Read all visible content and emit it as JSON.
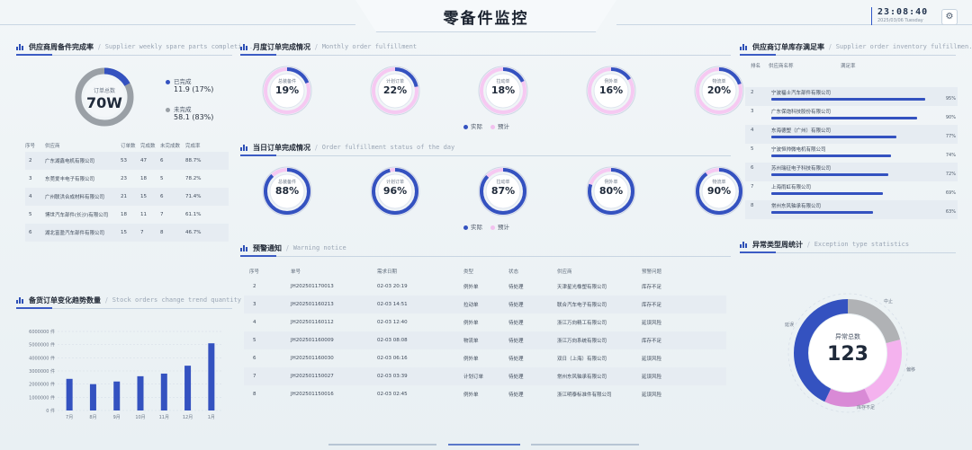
{
  "header": {
    "title": "零备件监控",
    "time": "23:08:40",
    "date": "2025/03/06  Tuesday"
  },
  "supplier_rate": {
    "title": "供应商周备件完成率",
    "subtitle": "Supplier weekly spare parts completi...",
    "center_label": "订单总数",
    "center_value": "70W",
    "completed_label": "已完成",
    "completed_value": "11.9 (17%)",
    "completed_fraction": 0.17,
    "pending_label": "未完成",
    "pending_value": "58.1 (83%)",
    "colors": {
      "completed": "#3452c0",
      "pending": "#9aa0a6"
    },
    "columns": [
      "序号",
      "供应商",
      "订单数",
      "完成数",
      "未完成数",
      "完成率"
    ],
    "rows": [
      [
        "2",
        "广东湖鑫电机有限公司",
        "53",
        "47",
        "6",
        "88.7%"
      ],
      [
        "3",
        "东莞爱丰电子有限公司",
        "23",
        "18",
        "5",
        "78.2%"
      ],
      [
        "4",
        "广州联洪合成材料有限公司",
        "21",
        "15",
        "6",
        "71.4%"
      ],
      [
        "5",
        "博世汽车部件(长沙)有限公司",
        "18",
        "11",
        "7",
        "61.1%"
      ],
      [
        "6",
        "湖北富盈汽车部件有限公司",
        "15",
        "7",
        "8",
        "46.7%"
      ]
    ]
  },
  "monthly": {
    "title": "月度订单完成情况",
    "subtitle": "Monthly order fulfillment",
    "gauges": [
      {
        "label": "总装备件",
        "pct": "19%",
        "value": 0.19
      },
      {
        "label": "计划订单",
        "pct": "22%",
        "value": 0.22
      },
      {
        "label": "拉动单",
        "pct": "18%",
        "value": 0.18
      },
      {
        "label": "例外单",
        "pct": "16%",
        "value": 0.16
      },
      {
        "label": "物流单",
        "pct": "20%",
        "value": 0.2
      }
    ],
    "legend_actual": "实际",
    "legend_plan": "预计"
  },
  "daily": {
    "title": "当日订单完成情况",
    "subtitle": "Order fulfillment status of the day",
    "gauges": [
      {
        "label": "总装备件",
        "pct": "88%",
        "value": 0.88
      },
      {
        "label": "计划订单",
        "pct": "96%",
        "value": 0.96
      },
      {
        "label": "拉动单",
        "pct": "87%",
        "value": 0.87
      },
      {
        "label": "例外单",
        "pct": "80%",
        "value": 0.8
      },
      {
        "label": "物流单",
        "pct": "90%",
        "value": 0.9
      }
    ],
    "legend_actual": "实际",
    "legend_plan": "预计"
  },
  "inventory": {
    "title": "供应商订单库存满足率",
    "subtitle": "Supplier order inventory fulfillmen...",
    "columns": [
      "排名",
      "供应商名称",
      "满足率"
    ],
    "rows": [
      {
        "rank": "2",
        "name": "宁波福士汽车部件有限公司",
        "pct": "95%",
        "value": 0.95
      },
      {
        "rank": "3",
        "name": "广东保炮科技股份有限公司",
        "pct": "90%",
        "value": 0.9
      },
      {
        "rank": "4",
        "name": "东海德塑（广州）有限公司",
        "pct": "77%",
        "value": 0.77
      },
      {
        "rank": "5",
        "name": "宁波恒帅微电机有限公司",
        "pct": "74%",
        "value": 0.74
      },
      {
        "rank": "6",
        "name": "苏州瑞征电子科技有限公司",
        "pct": "72%",
        "value": 0.72
      },
      {
        "rank": "7",
        "name": "上海雨虹有限公司",
        "pct": "69%",
        "value": 0.69
      },
      {
        "rank": "8",
        "name": "常州东风轴承有限公司",
        "pct": "63%",
        "value": 0.63
      }
    ]
  },
  "trend": {
    "title": "备货订单变化趋势数量",
    "subtitle": "Stock orders change trend quantity",
    "chart_data": {
      "type": "bar",
      "categories": [
        "7月",
        "8月",
        "9月",
        "10月",
        "11月",
        "12月",
        "1月"
      ],
      "values": [
        2400000,
        2000000,
        2200000,
        2600000,
        2800000,
        3400000,
        5100000
      ],
      "y_ticks": [
        "0 件",
        "1000000 件",
        "2000000 件",
        "3000000 件",
        "4000000 件",
        "5000000 件",
        "6000000 件"
      ],
      "ylim": [
        0,
        6000000
      ],
      "color": "#3452c0"
    }
  },
  "warning": {
    "title": "预警通知",
    "subtitle": "Warning notice",
    "columns": [
      "序号",
      "单号",
      "需求日期",
      "类型",
      "状态",
      "供应商",
      "预警问题"
    ],
    "rows": [
      [
        "2",
        "JH202501170013",
        "02-03 20:19",
        "例外单",
        "待处理",
        "天津星光橡塑有限公司",
        "库存不足"
      ],
      [
        "3",
        "JH202501160213",
        "02-03 14:51",
        "拉动单",
        "待处理",
        "联合汽车电子有限公司",
        "库存不足"
      ],
      [
        "4",
        "JH202501160112",
        "02-03 12:40",
        "例外单",
        "待处理",
        "浙江万向精工有限公司",
        "延误风险"
      ],
      [
        "5",
        "JH202501160009",
        "02-03 08:08",
        "物流单",
        "待处理",
        "浙江万向系统有限公司",
        "库存不足"
      ],
      [
        "6",
        "JH202501160030",
        "02-03 06:16",
        "例外单",
        "待处理",
        "双日（上海）有限公司",
        "延误风险"
      ],
      [
        "7",
        "JH202501150027",
        "02-03 03:39",
        "计划订单",
        "待处理",
        "常州东风轴承有限公司",
        "延误风险"
      ],
      [
        "8",
        "JH202501150016",
        "02-03 02:45",
        "例外单",
        "待处理",
        "浙江明泰标准件有限公司",
        "延误风险"
      ]
    ]
  },
  "exception": {
    "title": "异常类型周统计",
    "subtitle": "Exception type statistics",
    "center_label": "异常总数",
    "center_value": "123",
    "chart_data": {
      "type": "pie",
      "categories": [
        "中止",
        "偏移",
        "库存不足",
        "延误"
      ],
      "values": [
        21,
        22,
        14,
        43
      ],
      "colors": [
        "#b0b2b5",
        "#f4b2ee",
        "#d98ad6",
        "#3452c0"
      ]
    }
  }
}
